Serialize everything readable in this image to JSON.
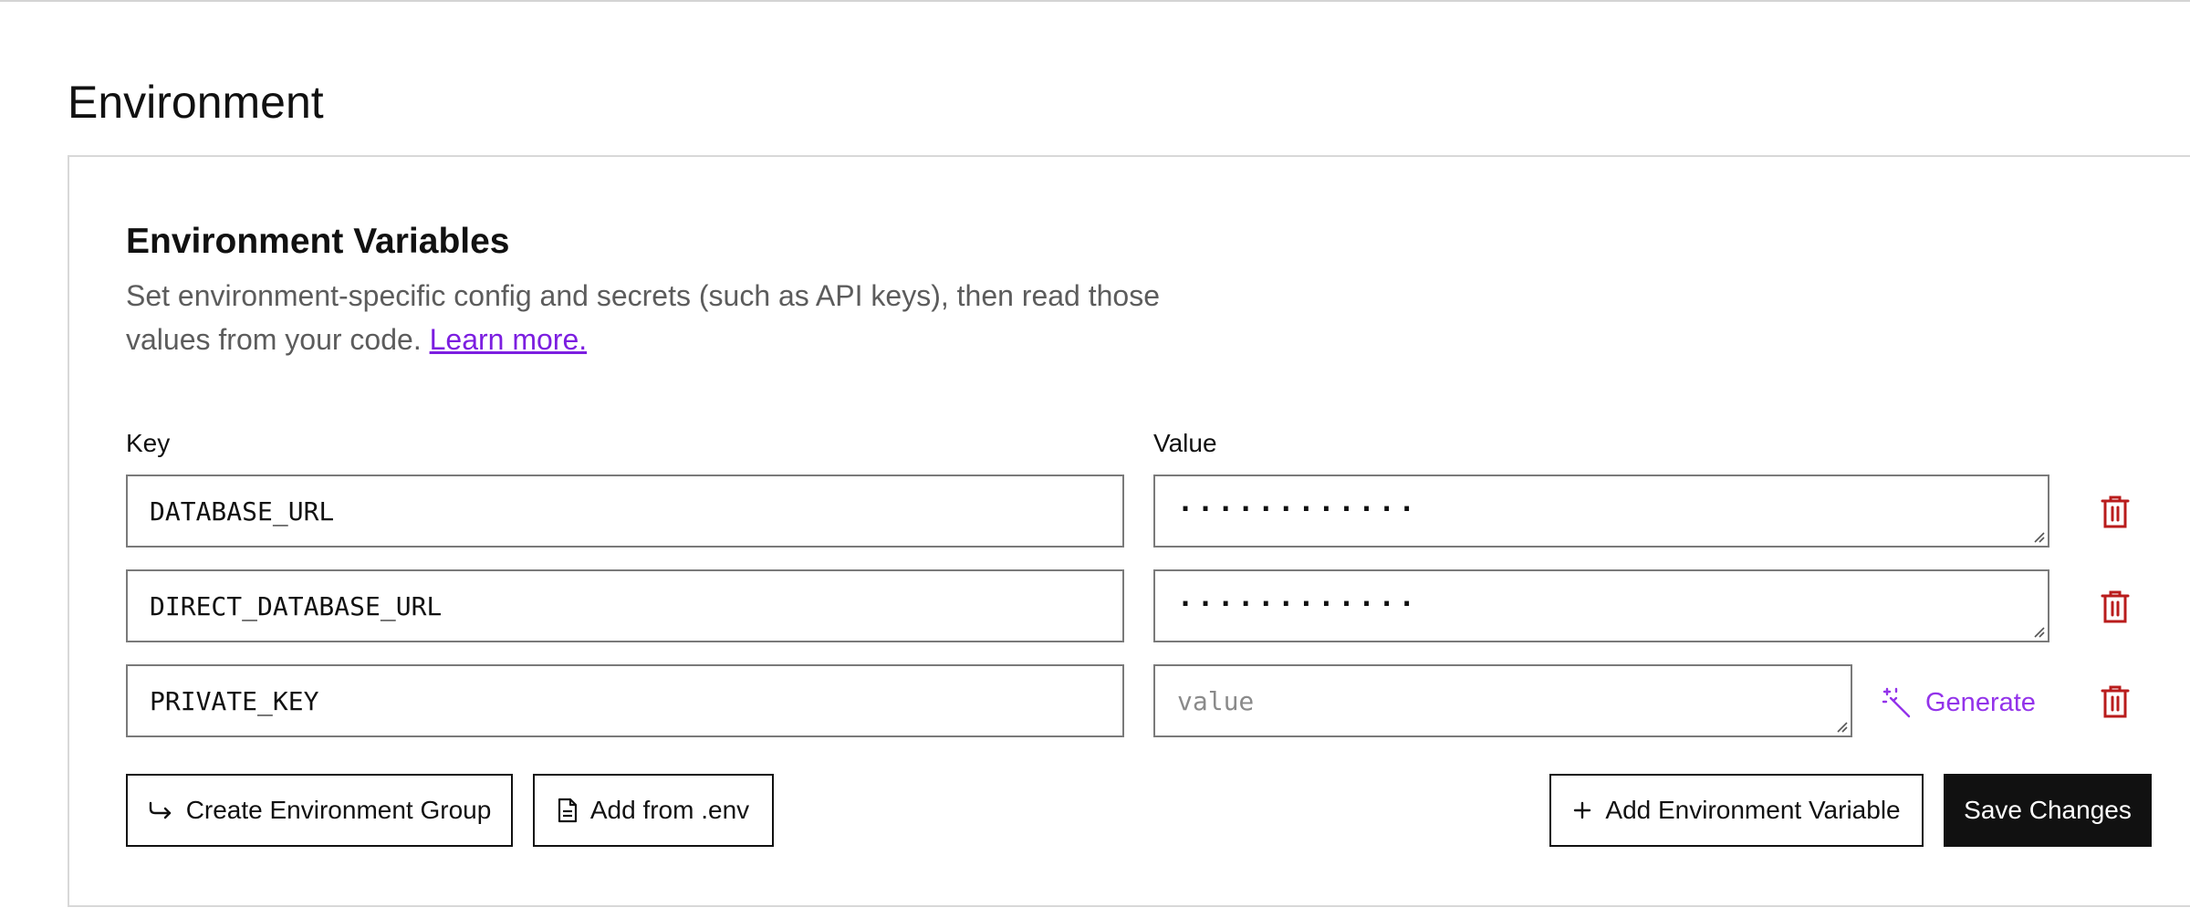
{
  "page": {
    "title": "Environment"
  },
  "env_section": {
    "title": "Environment Variables",
    "description": "Set environment-specific config and secrets (such as API keys), then read those values from your code.",
    "learn_more": "Learn more.",
    "key_label": "Key",
    "value_label": "Value",
    "rows": [
      {
        "key": "DATABASE_URL",
        "value": "············",
        "value_placeholder": ""
      },
      {
        "key": "DIRECT_DATABASE_URL",
        "value": "············",
        "value_placeholder": ""
      },
      {
        "key": "PRIVATE_KEY",
        "value": "",
        "value_placeholder": "value"
      }
    ],
    "generate_label": "Generate"
  },
  "actions": {
    "create_group": "Create Environment Group",
    "add_from_env": "Add from .env",
    "add_variable": "Add Environment Variable",
    "save": "Save Changes"
  },
  "colors": {
    "accent": "#7c1ee0",
    "generate": "#9333ea",
    "danger": "#b91c1c",
    "primary_button": "#111111"
  },
  "icons": {
    "delete": "trash-icon",
    "generate": "magic-wand-icon",
    "create_group": "share-arrow-icon",
    "add_from_env": "file-icon",
    "add_variable": "plus-icon"
  }
}
